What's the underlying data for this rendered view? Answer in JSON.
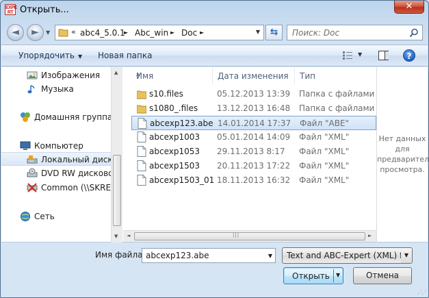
{
  "window": {
    "title": "Открыть...",
    "app_icon_text": "EXPE\nRT",
    "close_label": "✕"
  },
  "nav": {
    "back_label": "◄",
    "forward_label": "►",
    "address": {
      "overflow": "«",
      "segments": [
        "abc4_5.0.1",
        "Abc_win",
        "Doc"
      ],
      "separator": "►"
    },
    "search_placeholder": "Поиск: Doc"
  },
  "toolbar": {
    "organize_label": "Упорядочить",
    "new_folder_label": "Новая папка"
  },
  "sidebar": {
    "items": [
      {
        "label": "Изображения",
        "icon": "pictures-icon",
        "selected": false
      },
      {
        "label": "Музыка",
        "icon": "music-icon",
        "selected": false
      },
      {
        "label": "Домашняя группа",
        "icon": "homegroup-icon",
        "selected": false
      },
      {
        "label": "Компьютер",
        "icon": "computer-icon",
        "selected": false
      },
      {
        "label": "Локальный диск (C",
        "icon": "local-disk-icon",
        "selected": true
      },
      {
        "label": "DVD RW дисковод",
        "icon": "dvd-drive-icon",
        "selected": false
      },
      {
        "label": "Common (\\\\SKREB",
        "icon": "network-drive-icon",
        "selected": false
      },
      {
        "label": "Сеть",
        "icon": "network-icon",
        "selected": false
      }
    ]
  },
  "filelist": {
    "columns": [
      "Имя",
      "Дата изменения",
      "Тип"
    ],
    "rows": [
      {
        "name": "s10.files",
        "date": "05.12.2013 13:39",
        "type": "Папка с файлами",
        "kind": "folder",
        "selected": false
      },
      {
        "name": "s1080_.files",
        "date": "13.12.2013 16:48",
        "type": "Папка с файлами",
        "kind": "folder",
        "selected": false
      },
      {
        "name": "abcexp123.abe",
        "date": "14.01.2014 17:37",
        "type": "Файл \"ABE\"",
        "kind": "file",
        "selected": true
      },
      {
        "name": "abcexp1003",
        "date": "05.01.2014 14:09",
        "type": "Файл \"XML\"",
        "kind": "file",
        "selected": false
      },
      {
        "name": "abcexp1053",
        "date": "29.11.2013 8:17",
        "type": "Файл \"XML\"",
        "kind": "file",
        "selected": false
      },
      {
        "name": "abcexp1503",
        "date": "20.11.2013 17:22",
        "type": "Файл \"XML\"",
        "kind": "file",
        "selected": false
      },
      {
        "name": "abcexp1503_01",
        "date": "18.11.2013 16:32",
        "type": "Файл \"XML\"",
        "kind": "file",
        "selected": false
      }
    ]
  },
  "preview": {
    "text": "Нет данных\nдля\nпредварительного\nпросмотра."
  },
  "bottom": {
    "filename_label": "Имя файла:",
    "filename_value": "abcexp123.abe",
    "filter_value": "Text and ABC-Expert (XML) files",
    "open_label": "Открыть",
    "cancel_label": "Отмена"
  },
  "colors": {
    "selection": "#cfe3f8",
    "accent": "#3c7fb1",
    "close": "#c7482f"
  }
}
